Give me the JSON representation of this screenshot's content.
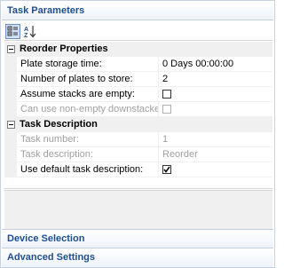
{
  "panel": {
    "task_parameters": "Task Parameters",
    "device_selection": "Device Selection",
    "advanced_settings": "Advanced Settings"
  },
  "toolbar": {
    "categorized_icon": "categorized-icon",
    "alphabetical_icon": "alphabetical-icon"
  },
  "categories": {
    "reorder": "Reorder Properties",
    "task_description": "Task Description"
  },
  "properties": {
    "plate_storage_time": {
      "name": "Plate storage time:",
      "value": "0 Days  00:00:00"
    },
    "number_of_plates": {
      "name": "Number of plates to store:",
      "value": "2"
    },
    "assume_stacks_empty": {
      "name": "Assume stacks are empty:",
      "checked": false
    },
    "non_empty_downstacker": {
      "name": "Can use non-empty downstacker:",
      "checked": false
    },
    "task_number": {
      "name": "Task number:",
      "value": "1"
    },
    "task_description": {
      "name": "Task description:",
      "value": "Reorder"
    },
    "use_default_description": {
      "name": "Use default task description:",
      "checked": true
    }
  },
  "colors": {
    "header_text": "#1f4e8c",
    "disabled_text": "#a0a0a0",
    "category_bg": "#f0f0f0"
  }
}
